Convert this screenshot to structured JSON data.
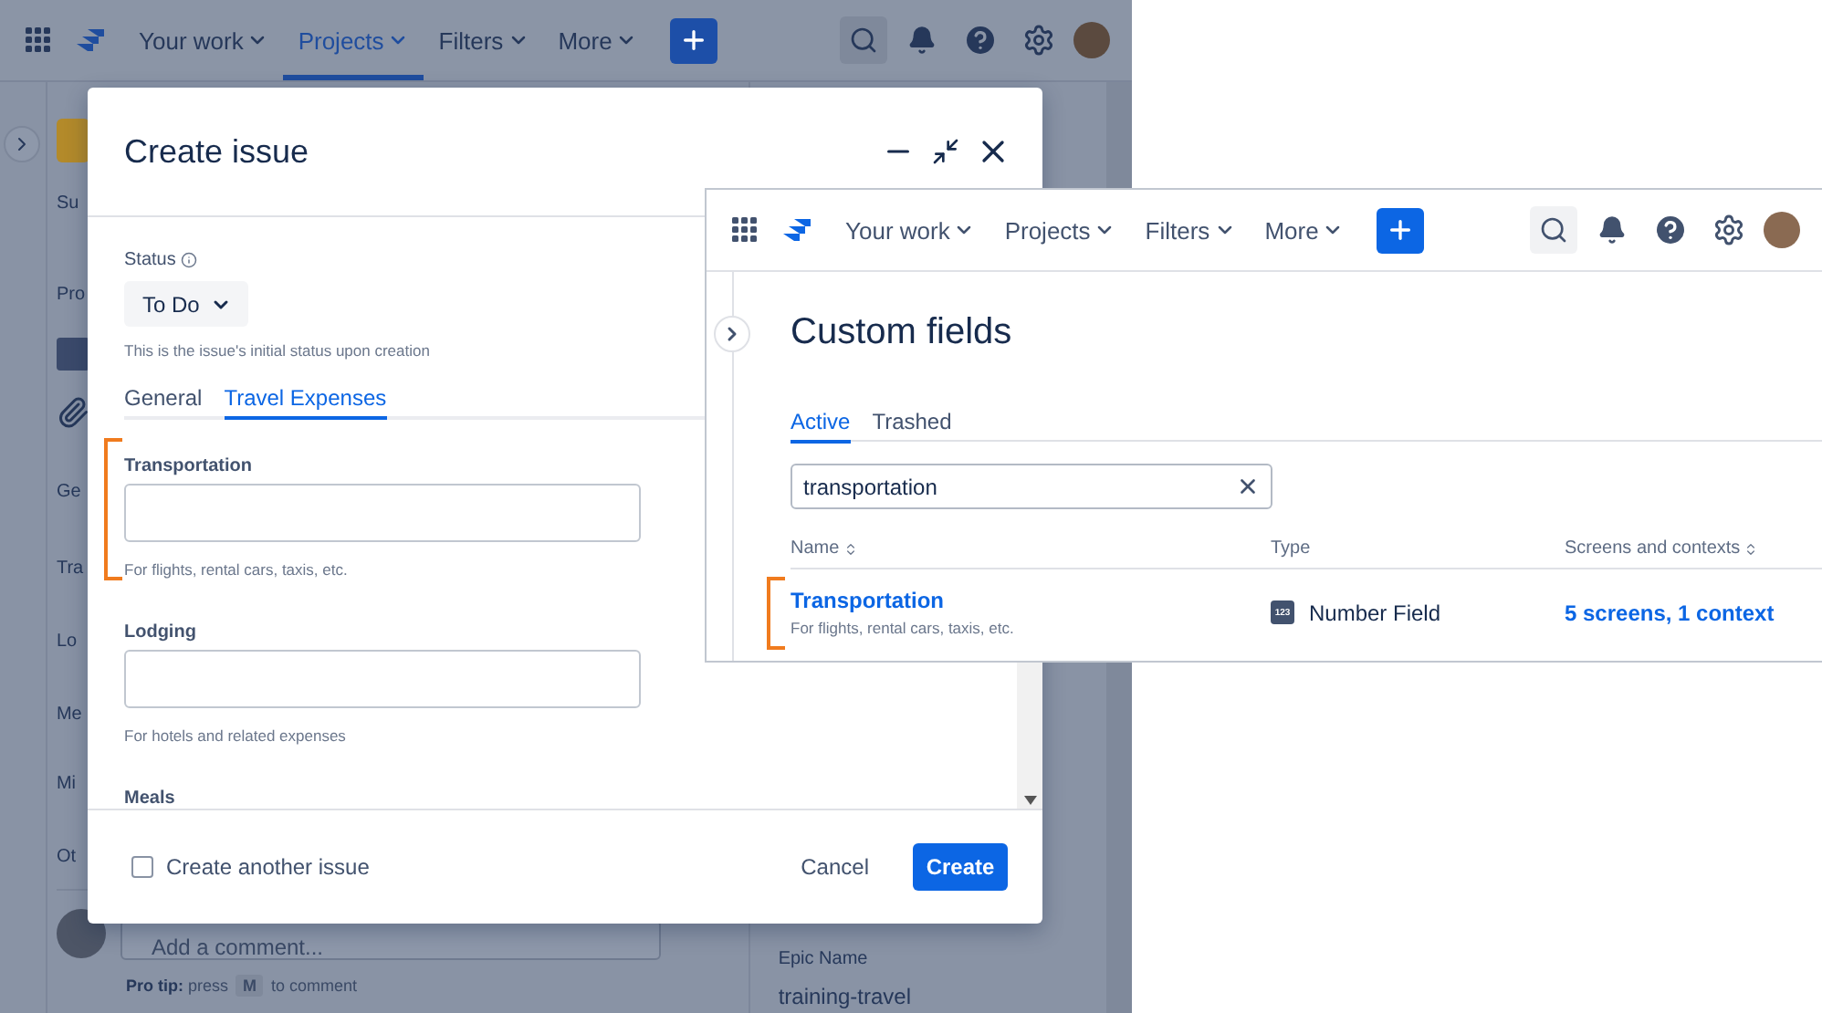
{
  "background": {
    "nav": {
      "items": [
        {
          "label": "Your work",
          "selected": false
        },
        {
          "label": "Projects",
          "selected": true
        },
        {
          "label": "Filters",
          "selected": false
        },
        {
          "label": "More",
          "selected": false
        }
      ]
    },
    "sidebar_labels": [
      "Su",
      "Pro",
      "Ge",
      "Tra",
      "Lo",
      "Me",
      "Mi",
      "Ot"
    ],
    "comment": {
      "placeholder": "Add a comment...",
      "tip_lead": "**Pro tip:** press",
      "tip_key": "M",
      "tip_tail": "to comment"
    },
    "epic_name": {
      "label": "Epic Name",
      "value": "training-travel"
    }
  },
  "create_issue_dialog": {
    "title": "Create issue",
    "status": {
      "label": "Status",
      "value": "To Do",
      "hint": "This is the issue's initial status upon creation"
    },
    "tabs": [
      {
        "label": "General",
        "selected": false
      },
      {
        "label": "Travel Expenses",
        "selected": true
      }
    ],
    "fields": [
      {
        "label": "Transportation",
        "hint": "For flights, rental cars, taxis, etc.",
        "highlighted": true
      },
      {
        "label": "Lodging",
        "hint": "For hotels and related expenses",
        "highlighted": false
      },
      {
        "label": "Meals"
      }
    ],
    "create_another": {
      "label": "Create another issue",
      "checked": false
    },
    "buttons": {
      "cancel": "Cancel",
      "create": "Create"
    }
  },
  "custom_fields_window": {
    "nav": {
      "items": [
        {
          "label": "Your work",
          "selected": false
        },
        {
          "label": "Projects",
          "selected": false
        },
        {
          "label": "Filters",
          "selected": false
        },
        {
          "label": "More",
          "selected": false
        }
      ]
    },
    "title": "Custom fields",
    "tabs": [
      {
        "label": "Active",
        "selected": true
      },
      {
        "label": "Trashed",
        "selected": false
      }
    ],
    "search": {
      "value": "transportation"
    },
    "table": {
      "columns": [
        {
          "label": "Name",
          "sortable": true
        },
        {
          "label": "Type",
          "sortable": false
        },
        {
          "label": "Screens and contexts",
          "sortable": true
        }
      ],
      "rows": [
        {
          "name": "Transportation",
          "description": "For flights, rental cars, taxis, etc.",
          "type_badge": "123",
          "type": "Number Field",
          "screens": "5 screens, 1 context",
          "highlighted": true
        }
      ]
    }
  }
}
